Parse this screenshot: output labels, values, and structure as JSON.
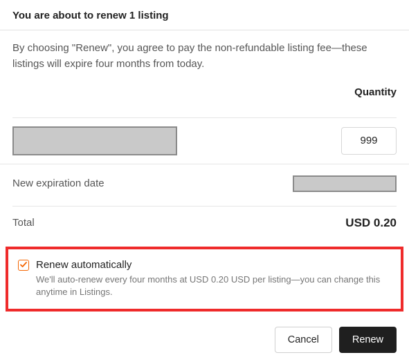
{
  "header": {
    "title": "You are about to renew 1 listing"
  },
  "intro": {
    "text": "By choosing \"Renew\", you agree to pay the non-refundable listing fee—these listings will expire four months from today."
  },
  "quantity": {
    "header_label": "Quantity",
    "value": "999"
  },
  "expiration": {
    "label": "New expiration date"
  },
  "total": {
    "label": "Total",
    "value": "USD 0.20"
  },
  "auto_renew": {
    "label": "Renew automatically",
    "description": "We'll auto-renew every four months at USD 0.20 USD per listing—you can change this anytime in Listings.",
    "checked": true
  },
  "footer": {
    "cancel_label": "Cancel",
    "renew_label": "Renew"
  }
}
